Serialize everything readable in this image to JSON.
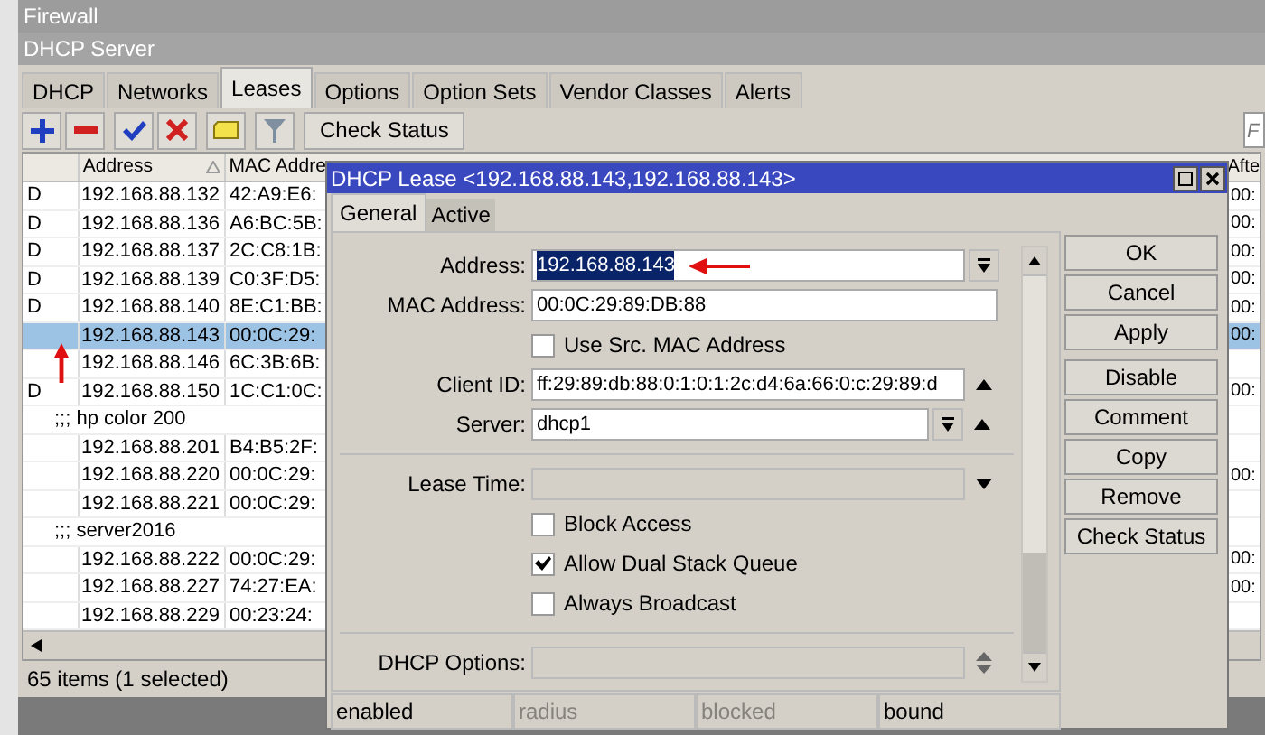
{
  "firewall_window": {
    "title": "Firewall"
  },
  "dhcp_server": {
    "title": "DHCP Server",
    "tabs": [
      {
        "label": "DHCP",
        "selected": false
      },
      {
        "label": "Networks",
        "selected": false
      },
      {
        "label": "Leases",
        "selected": true
      },
      {
        "label": "Options",
        "selected": false
      },
      {
        "label": "Option Sets",
        "selected": false
      },
      {
        "label": "Vendor Classes",
        "selected": false
      },
      {
        "label": "Alerts",
        "selected": false
      }
    ],
    "check_status_button": "Check Status",
    "search": {
      "placeholder": "F"
    },
    "table": {
      "columns": [
        "Address",
        "MAC Addre",
        "Afte"
      ],
      "rows": [
        {
          "kind": "lease",
          "flag": "D",
          "address": "192.168.88.132",
          "mac": "42:A9:E6:",
          "after": "00:",
          "selected": false
        },
        {
          "kind": "lease",
          "flag": "D",
          "address": "192.168.88.136",
          "mac": "A6:BC:5B:",
          "after": "00:",
          "selected": false
        },
        {
          "kind": "lease",
          "flag": "D",
          "address": "192.168.88.137",
          "mac": "2C:C8:1B:",
          "after": "00:",
          "selected": false
        },
        {
          "kind": "lease",
          "flag": "D",
          "address": "192.168.88.139",
          "mac": "C0:3F:D5:",
          "after": "00:",
          "selected": false
        },
        {
          "kind": "lease",
          "flag": "D",
          "address": "192.168.88.140",
          "mac": "8E:C1:BB:",
          "after": "00:",
          "selected": false
        },
        {
          "kind": "lease",
          "address": "192.168.88.143",
          "mac": "00:0C:29:",
          "after": "00:",
          "selected": true
        },
        {
          "kind": "lease",
          "address": "192.168.88.146",
          "mac": "6C:3B:6B:",
          "selected": false
        },
        {
          "kind": "lease",
          "flag": "D",
          "address": "192.168.88.150",
          "mac": "1C:C1:0C:",
          "after": "00:",
          "selected": false
        },
        {
          "kind": "comment",
          "text": ";;; hp color 200"
        },
        {
          "kind": "lease",
          "address": "192.168.88.201",
          "mac": "B4:B5:2F:",
          "selected": false
        },
        {
          "kind": "lease",
          "address": "192.168.88.220",
          "mac": "00:0C:29:",
          "after": "00:",
          "selected": false
        },
        {
          "kind": "lease",
          "address": "192.168.88.221",
          "mac": "00:0C:29:",
          "selected": false
        },
        {
          "kind": "comment",
          "text": ";;; server2016"
        },
        {
          "kind": "lease",
          "address": "192.168.88.222",
          "mac": "00:0C:29:",
          "after": "00:",
          "selected": false
        },
        {
          "kind": "lease",
          "address": "192.168.88.227",
          "mac": "74:27:EA:",
          "after": "00:",
          "selected": false
        },
        {
          "kind": "lease",
          "address": "192.168.88.229",
          "mac": "00:23:24:",
          "selected": false
        }
      ]
    },
    "status": "65 items (1 selected)"
  },
  "dialog": {
    "title": "DHCP Lease <192.168.88.143,192.168.88.143>",
    "tabs": [
      {
        "label": "General",
        "selected": true
      },
      {
        "label": "Active",
        "selected": false
      }
    ],
    "fields": [
      {
        "kind": "text",
        "label": "Address:",
        "value": "192.168.88.143",
        "highlighted": true,
        "dropdown": true,
        "up_arrow": false,
        "down_arrow": false
      },
      {
        "kind": "text",
        "label": "MAC Address:",
        "value": "00:0C:29:89:DB:88",
        "highlighted": false,
        "dropdown": false,
        "up_arrow": false,
        "down_arrow": false
      },
      {
        "kind": "checkbox",
        "label": "Use Src. MAC Address",
        "checked": false
      },
      {
        "kind": "text",
        "label": "Client ID:",
        "value": "ff:29:89:db:88:0:1:0:1:2c:d4:6a:66:0:c:29:89:d",
        "highlighted": false,
        "dropdown": false,
        "up_arrow": true,
        "down_arrow": false
      },
      {
        "kind": "text",
        "label": "Server:",
        "value": "dhcp1",
        "highlighted": false,
        "dropdown": true,
        "up_arrow": true,
        "down_arrow": false
      },
      {
        "kind": "divider"
      },
      {
        "kind": "text",
        "label": "Lease Time:",
        "disabled": true,
        "highlighted": false,
        "dropdown": false,
        "up_arrow": false,
        "down_arrow": true
      },
      {
        "kind": "checkbox",
        "label": "Block Access",
        "checked": false
      },
      {
        "kind": "checkbox",
        "label": "Allow Dual Stack Queue",
        "checked": true
      },
      {
        "kind": "checkbox",
        "label": "Always Broadcast",
        "checked": false
      },
      {
        "kind": "divider"
      },
      {
        "kind": "text",
        "label": "DHCP Options:",
        "disabled": true,
        "highlighted": false,
        "dropdown": false,
        "up_arrow": true,
        "down_arrow": true
      }
    ],
    "buttons": [
      "OK",
      "Cancel",
      "Apply",
      "Disable",
      "Comment",
      "Copy",
      "Remove",
      "Check Status"
    ],
    "status_bar": [
      {
        "text": "enabled",
        "disabled": false
      },
      {
        "text": "radius",
        "disabled": true
      },
      {
        "text": "blocked",
        "disabled": true
      },
      {
        "text": "bound",
        "disabled": false
      }
    ]
  }
}
